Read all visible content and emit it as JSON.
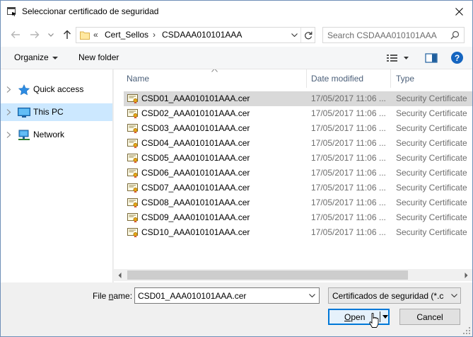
{
  "window": {
    "title": "Seleccionar certificado de seguridad"
  },
  "address": {
    "overflow": "«",
    "crumbs": [
      "Cert_Sellos",
      "CSDAAA010101AAA"
    ],
    "separator": "›",
    "search_placeholder": "Search CSDAAA010101AAA"
  },
  "toolbar": {
    "organize": "Organize",
    "new_folder": "New folder",
    "help": "?"
  },
  "nav": {
    "items": [
      {
        "label": "Quick access",
        "icon": "star-icon",
        "selected": false
      },
      {
        "label": "This PC",
        "icon": "computer-icon",
        "selected": true
      },
      {
        "label": "Network",
        "icon": "network-icon",
        "selected": false
      }
    ]
  },
  "list": {
    "columns": [
      "Name",
      "Date modified",
      "Type"
    ],
    "rows": [
      {
        "name": "CSD01_AAA010101AAA.cer",
        "date": "17/05/2017 11:06 ...",
        "type": "Security Certificate",
        "selected": true
      },
      {
        "name": "CSD02_AAA010101AAA.cer",
        "date": "17/05/2017 11:06 ...",
        "type": "Security Certificate",
        "selected": false
      },
      {
        "name": "CSD03_AAA010101AAA.cer",
        "date": "17/05/2017 11:06 ...",
        "type": "Security Certificate",
        "selected": false
      },
      {
        "name": "CSD04_AAA010101AAA.cer",
        "date": "17/05/2017 11:06 ...",
        "type": "Security Certificate",
        "selected": false
      },
      {
        "name": "CSD05_AAA010101AAA.cer",
        "date": "17/05/2017 11:06 ...",
        "type": "Security Certificate",
        "selected": false
      },
      {
        "name": "CSD06_AAA010101AAA.cer",
        "date": "17/05/2017 11:06 ...",
        "type": "Security Certificate",
        "selected": false
      },
      {
        "name": "CSD07_AAA010101AAA.cer",
        "date": "17/05/2017 11:06 ...",
        "type": "Security Certificate",
        "selected": false
      },
      {
        "name": "CSD08_AAA010101AAA.cer",
        "date": "17/05/2017 11:06 ...",
        "type": "Security Certificate",
        "selected": false
      },
      {
        "name": "CSD09_AAA010101AAA.cer",
        "date": "17/05/2017 11:06 ...",
        "type": "Security Certificate",
        "selected": false
      },
      {
        "name": "CSD10_AAA010101AAA.cer",
        "date": "17/05/2017 11:06 ...",
        "type": "Security Certificate",
        "selected": false
      }
    ]
  },
  "bottom": {
    "file_name_label_pre": "File ",
    "file_name_label_u": "n",
    "file_name_label_post": "ame:",
    "file_name_value": "CSD01_AAA010101AAA.cer",
    "filter_value": "Certificados de seguridad (*.cer",
    "open_u": "O",
    "open_rest": "pen",
    "cancel": "Cancel"
  },
  "colors": {
    "selection_nav": "#cce8ff",
    "selection_row": "#d9d9d9",
    "accent": "#0078d7",
    "help_blue": "#1565c0"
  }
}
